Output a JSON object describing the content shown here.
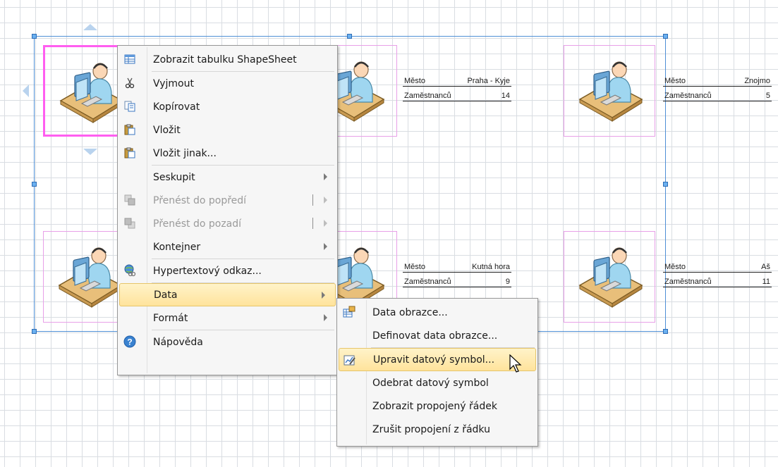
{
  "shapes": [
    {
      "id": "s1",
      "selected": true
    },
    {
      "id": "s2",
      "selected": false,
      "city_label": "Město",
      "city_value": "Praha - Kyje",
      "emp_label": "Zaměstnanců",
      "emp_value": "14"
    },
    {
      "id": "s3",
      "selected": false,
      "city_label": "Město",
      "city_value": "Znojmo",
      "emp_label": "Zaměstnanců",
      "emp_value": "5"
    },
    {
      "id": "s4",
      "selected": false
    },
    {
      "id": "s5",
      "selected": false,
      "city_label": "Město",
      "city_value": "Kutná hora",
      "emp_label": "Zaměstnanců",
      "emp_value": "9"
    },
    {
      "id": "s6",
      "selected": false,
      "city_label": "Město",
      "city_value": "Aš",
      "emp_label": "Zaměstnanců",
      "emp_value": "11"
    }
  ],
  "context_menu": {
    "items": [
      {
        "label": "Zobrazit tabulku ShapeSheet",
        "icon": "shapesheet-table-icon"
      },
      {
        "label": "Vyjmout",
        "icon": "scissors-icon"
      },
      {
        "label": "Kopírovat",
        "icon": "copy-icon"
      },
      {
        "label": "Vložit",
        "icon": "paste-icon"
      },
      {
        "label": "Vložit jinak...",
        "icon": "paste-special-icon"
      },
      {
        "label": "Seskupit",
        "submenu": true
      },
      {
        "label": "Přenést do popředí",
        "icon": "bring-to-front-icon",
        "disabled": true,
        "submenu": true
      },
      {
        "label": "Přenést do pozadí",
        "icon": "send-to-back-icon",
        "disabled": true,
        "submenu": true
      },
      {
        "label": "Kontejner",
        "submenu": true
      },
      {
        "label": "Hypertextový odkaz...",
        "icon": "hyperlink-globe-icon"
      },
      {
        "label": "Data",
        "submenu": true,
        "highlighted": true
      },
      {
        "label": "Formát",
        "submenu": true
      },
      {
        "label": "Nápověda",
        "icon": "help-icon"
      }
    ]
  },
  "data_submenu": {
    "items": [
      {
        "label": "Data obrazce...",
        "icon": "shape-data-icon"
      },
      {
        "label": "Definovat data obrazce..."
      },
      {
        "label": "Upravit datový symbol...",
        "icon": "edit-data-graphic-icon",
        "highlighted": true
      },
      {
        "label": "Odebrat datový symbol"
      },
      {
        "label": "Zobrazit propojený řádek"
      },
      {
        "label": "Zrušit propojení z řádku"
      }
    ]
  },
  "colors": {
    "selection": "#4f8fd6",
    "shape_border": "#e8a0e8",
    "selected_shape_border": "#ff5ef0",
    "menu_highlight": "#ffe39c"
  }
}
